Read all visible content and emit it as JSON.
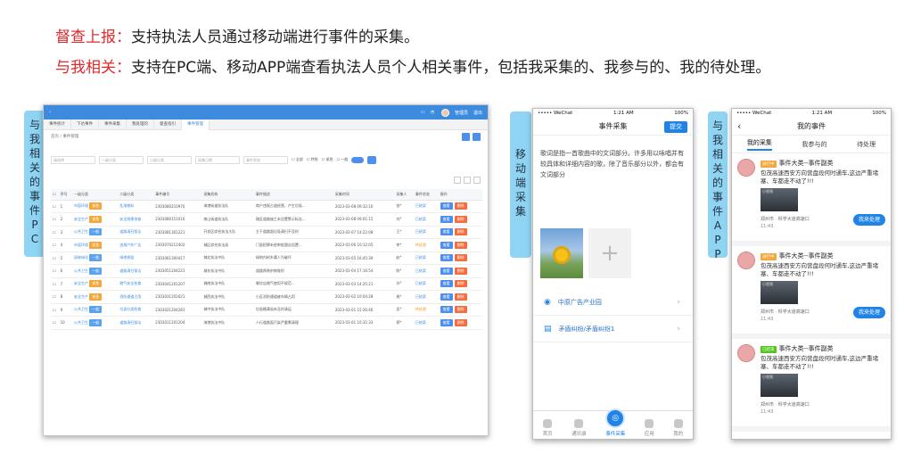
{
  "headings": [
    {
      "label": "督查上报：",
      "text": "支持执法人员通过移动端进行事件的采集。"
    },
    {
      "label": "与我相关：",
      "text": "支持在PC端、移动APP端查看执法人员个人相关事件，包括我采集的、我参与的、我的待处理。"
    }
  ],
  "side_tabs": {
    "pc": [
      "与",
      "我",
      "相",
      "关",
      "的",
      "事",
      "件",
      "P",
      "C"
    ],
    "mobile": [
      "移",
      "动",
      "端",
      "采",
      "集"
    ],
    "app": [
      "与",
      "我",
      "相",
      "关",
      "的",
      "事",
      "件",
      "A",
      "P",
      "P"
    ]
  },
  "colors": {
    "accent": "#1f83e8",
    "highlight": "#e0292b",
    "tab": "#8fd4f2"
  },
  "pc": {
    "header_items": [
      "管理员",
      "退出"
    ],
    "tabs": [
      "事件统计",
      "下达事件",
      "事件采集",
      "我处理的",
      "督查指引",
      "事件管理"
    ],
    "breadcrumb": "首页 / 事件管理",
    "filters": [
      "请选择",
      "一级分类",
      "二级分类",
      "采集日期",
      "事件状态"
    ],
    "checkboxes": [
      "全部",
      "特急",
      "紧急",
      "一般"
    ],
    "columns": [
      "序号",
      "一级分类",
      "二级分类",
      "事件编号",
      "采集机构",
      "事件描述",
      "采集时间",
      "采集人",
      "事件状态",
      "操作"
    ],
    "rows": [
      [
        "1",
        "市容环境",
        "乱堆物料",
        "2303080210970",
        "海港街道执法队",
        "商户违规占道经营，产生垃圾...",
        "2023-03-08 09:32:16",
        "张*",
        "已结案"
      ],
      [
        "2",
        "安全生产",
        "安全隐患排查",
        "2303080151016",
        "南山街道执法队",
        "辖区道路施工未设置警示标志...",
        "2023-03-08 09:01:15",
        "刘*",
        "已结案"
      ],
      [
        "3",
        "公共卫生",
        "道路清扫保洁",
        "2303081301221",
        "开发区综合执法大队",
        "主干道路面垃圾清扫不及时",
        "2023-03-07 14:22:08",
        "王*",
        "已结案"
      ],
      [
        "4",
        "市容环境",
        "违规户外广告",
        "2303070211402",
        "城区综合执法局",
        "门面招牌未经审批擅自设置...",
        "2023-03-06 10:12:05",
        "李*",
        "待处理"
      ],
      [
        "5",
        "园林绿化",
        "绿地损毁",
        "2303061300417",
        "城北执法中队",
        "绿地内树木遭人为破坏",
        "2023-03-05 16:45:39",
        "赵*",
        "已结案"
      ],
      [
        "6",
        "公共卫生",
        "道路清扫保洁",
        "2303051204221",
        "城东执法中队",
        "道路两侧杂物堆积",
        "2023-03-04 17:16:54",
        "陈*",
        "已结案"
      ],
      [
        "7",
        "安全生产",
        "燃气安全检查",
        "2303041201207",
        "城南执法中队",
        "餐饮店燃气使用不规范...",
        "2023-03-03 14:25:21",
        "孙*",
        "已结案"
      ],
      [
        "8",
        "安全生产",
        "消防通道占用",
        "2303031201621",
        "城西执法中队",
        "小区消防通道被车辆占用",
        "2023-03-02 10:04:28",
        "周*",
        "已结案"
      ],
      [
        "9",
        "公共卫生",
        "垃圾分类检查",
        "2303021204281",
        "城中执法中队",
        "垃圾桶满溢未及时清运",
        "2023-03-01 15:26:46",
        "吴*",
        "待处理"
      ],
      [
        "10",
        "公共卫生",
        "道路清扫保洁",
        "2303011201204",
        "海港执法中队",
        "人行道路面污染严重需清理",
        "2023-03-01 10:31:33",
        "郑*",
        "已结案"
      ]
    ],
    "row_actions": [
      "查看",
      "删除"
    ]
  },
  "mobile": {
    "status_left": "••••• WeChat",
    "status_time": "1:21 AM",
    "status_right": "100%",
    "title": "事件采集",
    "submit": "提交",
    "description": "歌词是指一首歌曲中的文词部分。许多用以咏唱并有较具体和详细内容的歌，除了音乐部分以外，都会有文词部分",
    "rows": [
      "中原广告产业园",
      "矛盾纠纷/矛盾纠纷1"
    ],
    "tabbar": [
      "首页",
      "通讯录",
      "事件采集",
      "应用",
      "我的"
    ]
  },
  "app": {
    "status_left": "••••• WeChat",
    "status_time": "1:21 AM",
    "status_right": "100%",
    "title": "我的事件",
    "tabs": [
      "我的采集",
      "我参与的",
      "待处理"
    ],
    "cards": [
      {
        "status": "进行中",
        "status_color": "#f4a63a",
        "title": "事件大类--事件副类",
        "desc": "包茂高速西安方向营盘段何时通车,这边严重堵塞、车都走不动了!!!",
        "thumb": "小视频",
        "addr": "郑州市 · 科学大道高速口",
        "time": "11:43",
        "action": "我来处理"
      },
      {
        "status": "进行中",
        "status_color": "#f4a63a",
        "title": "事件大类--事件副类",
        "desc": "包茂高速西安方向营盘段何时通车,这边严重堵塞、车都走不动了!!!",
        "thumb": "小视频",
        "addr": "郑州市 · 科学大道高速口",
        "time": "11:43",
        "action": "我来处理"
      },
      {
        "status": "已结束",
        "status_color": "#52c41a",
        "title": "事件大类--事件副类",
        "desc": "包茂高速西安方向营盘段何时通车,这边严重堵塞、车都走不动了!!!",
        "thumb": "小视频",
        "addr": "郑州市 · 科学大道高速口",
        "time": "11:43",
        "action": ""
      }
    ]
  }
}
